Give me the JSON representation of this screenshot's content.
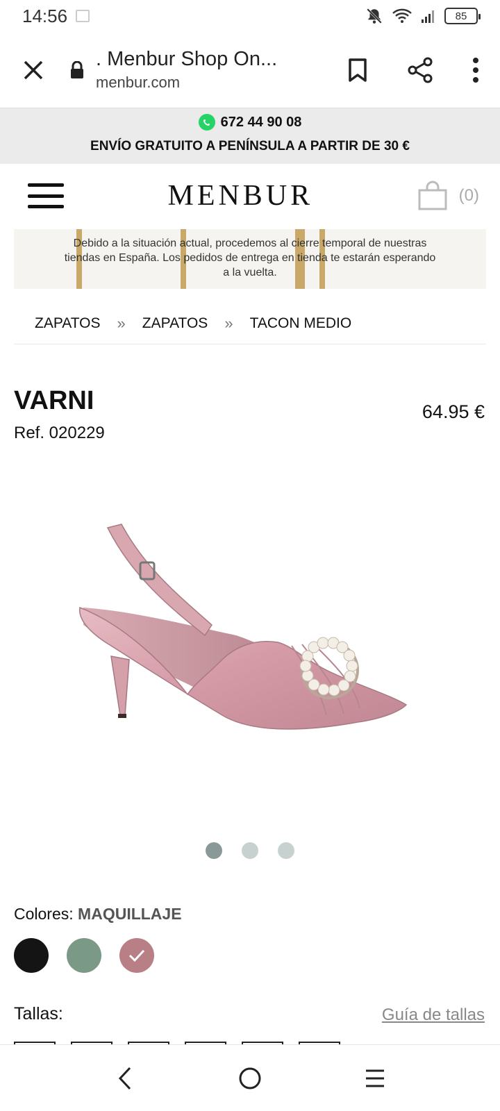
{
  "status": {
    "time": "14:56",
    "battery": "85"
  },
  "browser": {
    "title": ". Menbur Shop On...",
    "domain": "menbur.com"
  },
  "promo": {
    "phone": "672 44 90 08",
    "shipping": "ENVÍO GRATUITO A PENÍNSULA A PARTIR DE 30 €"
  },
  "header": {
    "logo": "MENBUR",
    "cart_count": "(0)"
  },
  "notice": {
    "line1": "Debido a la situación actual, procedemos al cierre temporal de nuestras",
    "line2": "tiendas en España. Los pedidos de entrega en tienda te estarán esperando",
    "line3": "a la vuelta."
  },
  "breadcrumb": {
    "items": [
      "ZAPATOS",
      "ZAPATOS",
      "TACON MEDIO"
    ],
    "separator": "»"
  },
  "product": {
    "name": "VARNI",
    "ref": "Ref. 020229",
    "price": "64.95 €"
  },
  "colors": {
    "label": "Colores:",
    "selected": "MAQUILLAJE",
    "swatches": [
      {
        "name": "black",
        "hex": "#141414"
      },
      {
        "name": "green",
        "hex": "#7a9987"
      },
      {
        "name": "pink",
        "hex": "#b87f86"
      }
    ]
  },
  "sizes": {
    "label": "Tallas:",
    "guide": "Guía de tallas"
  },
  "carousel": {
    "count": 3,
    "active": 1
  }
}
